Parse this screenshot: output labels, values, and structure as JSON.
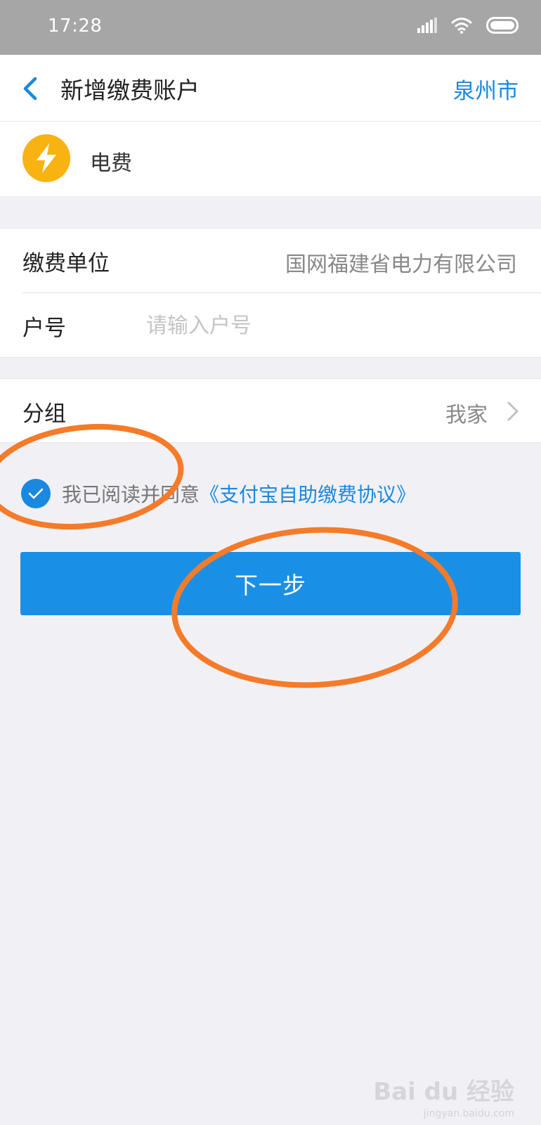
{
  "status_bar": {
    "time": "17:28"
  },
  "nav": {
    "title": "新增缴费账户",
    "city": "泉州市"
  },
  "service": {
    "name": "电费",
    "icon": "lightning-icon",
    "icon_color": "#f8b312"
  },
  "form": {
    "unit_label": "缴费单位",
    "unit_value": "国网福建省电力有限公司",
    "account_label": "户号",
    "account_placeholder": "请输入户号",
    "account_value": ""
  },
  "group": {
    "label": "分组",
    "value": "我家"
  },
  "agreement": {
    "checked": true,
    "text": "我已阅读并同意",
    "link_text": "《支付宝自助缴费协议》"
  },
  "next_button": {
    "label": "下一步"
  },
  "watermark": {
    "main": "Bai du 经验",
    "sub": "jingyan.baidu.com"
  },
  "colors": {
    "accent": "#1b88e0",
    "button": "#1a8fe6",
    "annotation": "#f47b2a",
    "background": "#f1f1f5"
  }
}
